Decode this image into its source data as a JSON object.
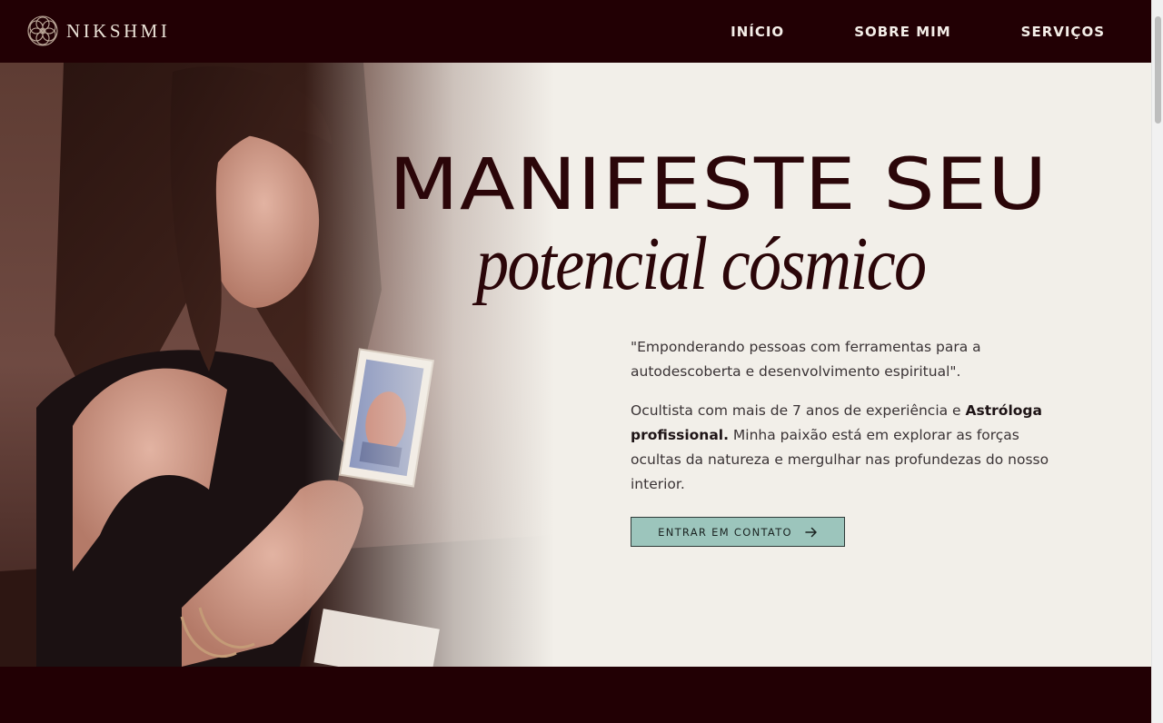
{
  "brand": {
    "name": "NIKSHMI",
    "logo_icon": "mandala-icon"
  },
  "nav": {
    "items": [
      {
        "label": "INÍCIO"
      },
      {
        "label": "SOBRE MIM"
      },
      {
        "label": "SERVIÇOS"
      }
    ]
  },
  "hero": {
    "headline": "MANIFESTE SEU",
    "subheadline": "potencial cósmico",
    "quote": "\"Emponderando pessoas com ferramentas para a autodescoberta e desenvolvimento espiritual\".",
    "bio": {
      "before": "Ocultista com mais de 7 anos de experiência e ",
      "bold": "Astróloga profissional.",
      "after": " Minha paixão está em explorar as forças ocultas da natureza e mergulhar nas profundezas do nosso interior."
    },
    "cta": {
      "label": "ENTRAR EM CONTATO",
      "icon": "arrow-right-icon"
    },
    "photo_description_icon": "tarot-reader-photo"
  },
  "colors": {
    "dark_bg": "#220004",
    "hero_bg": "#f2efe9",
    "headline": "#2b0609",
    "button_bg": "#9cc5bc",
    "nav_text": "#f4eee8"
  }
}
